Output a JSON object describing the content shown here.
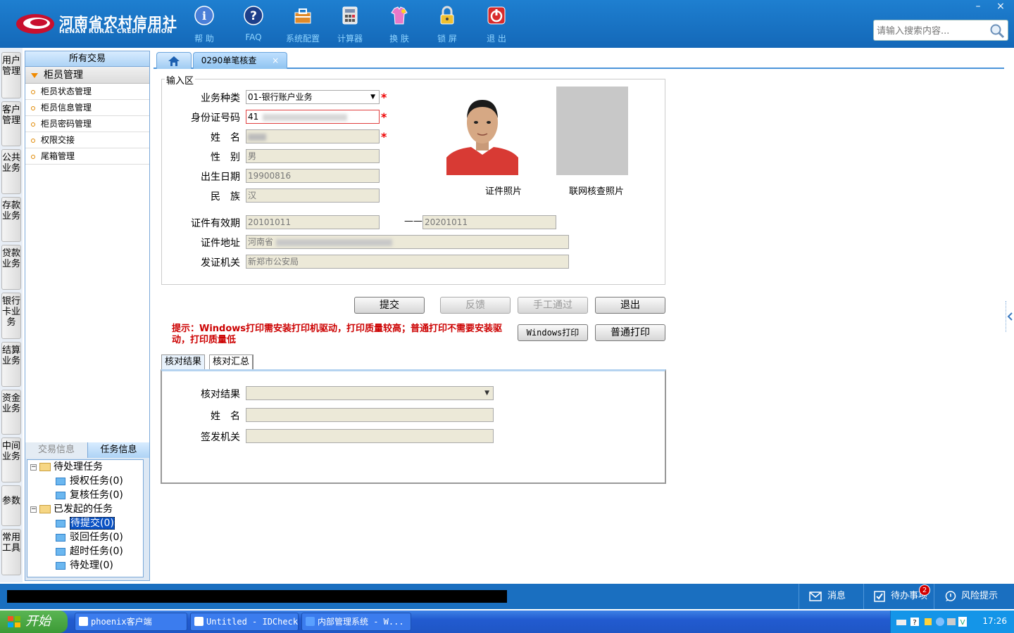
{
  "brand": {
    "name_cn": "河南省农村信用社",
    "name_en": "HENAN RURAL CREDIT UNION",
    "color": "#c8102e"
  },
  "toolbar": [
    {
      "label": "帮 助",
      "icon": "info-icon"
    },
    {
      "label": "FAQ",
      "icon": "help-icon"
    },
    {
      "label": "系统配置",
      "icon": "toolbox-icon"
    },
    {
      "label": "计算器",
      "icon": "calculator-icon"
    },
    {
      "label": "换 肤",
      "icon": "skin-icon"
    },
    {
      "label": "锁 屏",
      "icon": "lock-icon"
    },
    {
      "label": "退 出",
      "icon": "power-icon"
    }
  ],
  "search": {
    "placeholder": "请输入搜索内容..."
  },
  "vtabs": [
    "用户管理",
    "客户管理",
    "公共业务",
    "存款业务",
    "贷款业务",
    "银行卡业务",
    "结算业务",
    "资金业务",
    "中间业务",
    "参数",
    "常用工具"
  ],
  "left_panel": {
    "header": "所有交易",
    "category": "柜员管理",
    "items": [
      "柜员状态管理",
      "柜员信息管理",
      "柜员密码管理",
      "权限交接",
      "尾箱管理"
    ],
    "bottom_tabs": [
      "交易信息",
      "任务信息"
    ],
    "tree": {
      "group1": "待处理任务",
      "group1_items": [
        "授权任务(0)",
        "复核任务(0)"
      ],
      "group2": "已发起的任务",
      "group2_items": [
        "待提交(0)",
        "驳回任务(0)",
        "超时任务(0)",
        "待处理(0)"
      ]
    }
  },
  "tabs": {
    "home": "home-icon",
    "active": "0290单笔核查",
    "close": "×"
  },
  "form": {
    "legend": "输入区",
    "business_type": {
      "label": "业务种类",
      "value": "01-银行账户业务"
    },
    "id_number": {
      "label": "身份证号码",
      "value": "41"
    },
    "name": {
      "label": "姓　名",
      "value": ""
    },
    "gender": {
      "label": "性　别",
      "value": "男"
    },
    "birth": {
      "label": "出生日期",
      "value": "19900816"
    },
    "ethnicity": {
      "label": "民　族",
      "value": "汉"
    },
    "valid_period": {
      "label": "证件有效期",
      "from": "20101011",
      "sep": "——",
      "to": "20201011"
    },
    "address": {
      "label": "证件地址",
      "value": "河南省"
    },
    "issuer": {
      "label": "发证机关",
      "value": "新郑市公安局"
    },
    "photo1_label": "证件照片",
    "photo2_label": "联网核查照片"
  },
  "buttons": {
    "submit": "提交",
    "feedback": "反馈",
    "manual": "手工通过",
    "exit": "退出",
    "win_print": "Windows打印",
    "normal_print": "普通打印"
  },
  "tip": "提示：Windows打印需安装打印机驱动，打印质量较高；普通打印不需要安装驱动，打印质量低",
  "result": {
    "tabs": [
      "核对结果",
      "核对汇总"
    ],
    "check_result": {
      "label": "核对结果",
      "value": ""
    },
    "name": {
      "label": "姓　名",
      "value": ""
    },
    "issuer": {
      "label": "签发机关",
      "value": ""
    }
  },
  "statusbar": {
    "messages": "消息",
    "todo": "待办事项",
    "todo_count": "2",
    "risk": "风险提示"
  },
  "taskbar": {
    "start": "开始",
    "tasks": [
      "phoenix客户端",
      "Untitled - IDCheck",
      "内部管理系统 - W..."
    ],
    "clock": "17:26"
  },
  "window": {
    "minimize": "–",
    "close": "×"
  }
}
